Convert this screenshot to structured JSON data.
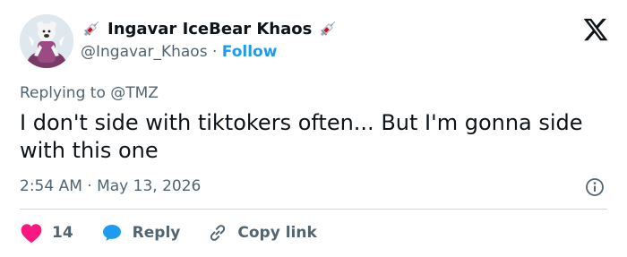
{
  "author": {
    "display_name": "Ingavar IceBear Khaos",
    "handle": "@Ingavar_Khaos",
    "separator": "·",
    "follow_label": "Follow",
    "name_emoji": "syringe-icon"
  },
  "brand": {
    "logo": "x-logo-icon"
  },
  "reply_context": "Replying to @TMZ",
  "tweet": {
    "text": "I don't side with tiktokers often... But I'm gonna side with this one",
    "timestamp": "2:54 AM · May 13, 2026"
  },
  "actions": {
    "like_count": "14",
    "reply_label": "Reply",
    "copy_link_label": "Copy link"
  },
  "colors": {
    "accent": "#1d9bf0",
    "like": "#f91880",
    "text_primary": "#0f1419",
    "text_secondary": "#536471",
    "divider": "#cfd9de"
  }
}
